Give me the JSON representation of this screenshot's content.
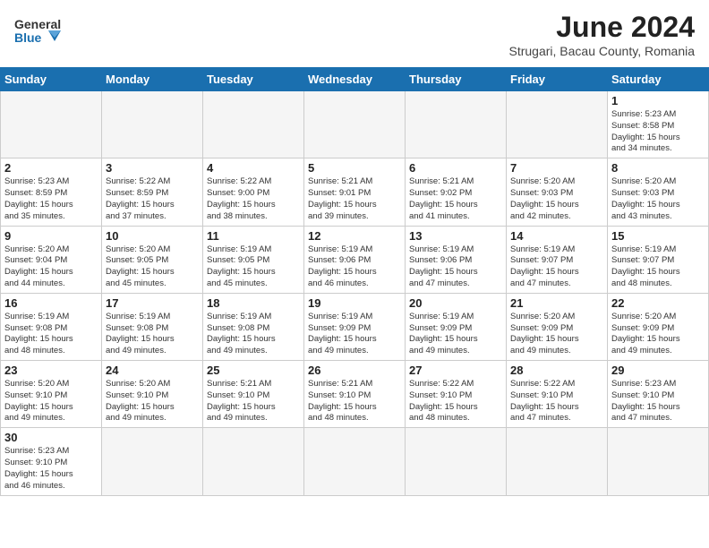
{
  "header": {
    "logo_general": "General",
    "logo_blue": "Blue",
    "month_year": "June 2024",
    "location": "Strugari, Bacau County, Romania"
  },
  "days_of_week": [
    "Sunday",
    "Monday",
    "Tuesday",
    "Wednesday",
    "Thursday",
    "Friday",
    "Saturday"
  ],
  "weeks": [
    [
      {
        "day": "",
        "empty": true
      },
      {
        "day": "",
        "empty": true
      },
      {
        "day": "",
        "empty": true
      },
      {
        "day": "",
        "empty": true
      },
      {
        "day": "",
        "empty": true
      },
      {
        "day": "",
        "empty": true
      },
      {
        "day": "1",
        "sunrise": "5:23 AM",
        "sunset": "8:58 PM",
        "daylight_hours": "15",
        "daylight_minutes": "34"
      }
    ],
    [
      {
        "day": "2",
        "sunrise": "5:23 AM",
        "sunset": "8:59 PM",
        "daylight_hours": "15",
        "daylight_minutes": "35"
      },
      {
        "day": "3",
        "sunrise": "5:22 AM",
        "sunset": "8:59 PM",
        "daylight_hours": "15",
        "daylight_minutes": "37"
      },
      {
        "day": "4",
        "sunrise": "5:22 AM",
        "sunset": "9:00 PM",
        "daylight_hours": "15",
        "daylight_minutes": "38"
      },
      {
        "day": "5",
        "sunrise": "5:21 AM",
        "sunset": "9:01 PM",
        "daylight_hours": "15",
        "daylight_minutes": "39"
      },
      {
        "day": "6",
        "sunrise": "5:21 AM",
        "sunset": "9:02 PM",
        "daylight_hours": "15",
        "daylight_minutes": "41"
      },
      {
        "day": "7",
        "sunrise": "5:20 AM",
        "sunset": "9:03 PM",
        "daylight_hours": "15",
        "daylight_minutes": "42"
      },
      {
        "day": "8",
        "sunrise": "5:20 AM",
        "sunset": "9:03 PM",
        "daylight_hours": "15",
        "daylight_minutes": "43"
      }
    ],
    [
      {
        "day": "9",
        "sunrise": "5:20 AM",
        "sunset": "9:04 PM",
        "daylight_hours": "15",
        "daylight_minutes": "44"
      },
      {
        "day": "10",
        "sunrise": "5:20 AM",
        "sunset": "9:05 PM",
        "daylight_hours": "15",
        "daylight_minutes": "45"
      },
      {
        "day": "11",
        "sunrise": "5:19 AM",
        "sunset": "9:05 PM",
        "daylight_hours": "15",
        "daylight_minutes": "45"
      },
      {
        "day": "12",
        "sunrise": "5:19 AM",
        "sunset": "9:06 PM",
        "daylight_hours": "15",
        "daylight_minutes": "46"
      },
      {
        "day": "13",
        "sunrise": "5:19 AM",
        "sunset": "9:06 PM",
        "daylight_hours": "15",
        "daylight_minutes": "47"
      },
      {
        "day": "14",
        "sunrise": "5:19 AM",
        "sunset": "9:07 PM",
        "daylight_hours": "15",
        "daylight_minutes": "47"
      },
      {
        "day": "15",
        "sunrise": "5:19 AM",
        "sunset": "9:07 PM",
        "daylight_hours": "15",
        "daylight_minutes": "48"
      }
    ],
    [
      {
        "day": "16",
        "sunrise": "5:19 AM",
        "sunset": "9:08 PM",
        "daylight_hours": "15",
        "daylight_minutes": "48"
      },
      {
        "day": "17",
        "sunrise": "5:19 AM",
        "sunset": "9:08 PM",
        "daylight_hours": "15",
        "daylight_minutes": "49"
      },
      {
        "day": "18",
        "sunrise": "5:19 AM",
        "sunset": "9:08 PM",
        "daylight_hours": "15",
        "daylight_minutes": "49"
      },
      {
        "day": "19",
        "sunrise": "5:19 AM",
        "sunset": "9:09 PM",
        "daylight_hours": "15",
        "daylight_minutes": "49"
      },
      {
        "day": "20",
        "sunrise": "5:19 AM",
        "sunset": "9:09 PM",
        "daylight_hours": "15",
        "daylight_minutes": "49"
      },
      {
        "day": "21",
        "sunrise": "5:20 AM",
        "sunset": "9:09 PM",
        "daylight_hours": "15",
        "daylight_minutes": "49"
      },
      {
        "day": "22",
        "sunrise": "5:20 AM",
        "sunset": "9:09 PM",
        "daylight_hours": "15",
        "daylight_minutes": "49"
      }
    ],
    [
      {
        "day": "23",
        "sunrise": "5:20 AM",
        "sunset": "9:10 PM",
        "daylight_hours": "15",
        "daylight_minutes": "49"
      },
      {
        "day": "24",
        "sunrise": "5:20 AM",
        "sunset": "9:10 PM",
        "daylight_hours": "15",
        "daylight_minutes": "49"
      },
      {
        "day": "25",
        "sunrise": "5:21 AM",
        "sunset": "9:10 PM",
        "daylight_hours": "15",
        "daylight_minutes": "49"
      },
      {
        "day": "26",
        "sunrise": "5:21 AM",
        "sunset": "9:10 PM",
        "daylight_hours": "15",
        "daylight_minutes": "48"
      },
      {
        "day": "27",
        "sunrise": "5:22 AM",
        "sunset": "9:10 PM",
        "daylight_hours": "15",
        "daylight_minutes": "48"
      },
      {
        "day": "28",
        "sunrise": "5:22 AM",
        "sunset": "9:10 PM",
        "daylight_hours": "15",
        "daylight_minutes": "47"
      },
      {
        "day": "29",
        "sunrise": "5:23 AM",
        "sunset": "9:10 PM",
        "daylight_hours": "15",
        "daylight_minutes": "47"
      }
    ],
    [
      {
        "day": "30",
        "sunrise": "5:23 AM",
        "sunset": "9:10 PM",
        "daylight_hours": "15",
        "daylight_minutes": "46"
      },
      {
        "day": "",
        "empty": true
      },
      {
        "day": "",
        "empty": true
      },
      {
        "day": "",
        "empty": true
      },
      {
        "day": "",
        "empty": true
      },
      {
        "day": "",
        "empty": true
      },
      {
        "day": "",
        "empty": true
      }
    ]
  ]
}
